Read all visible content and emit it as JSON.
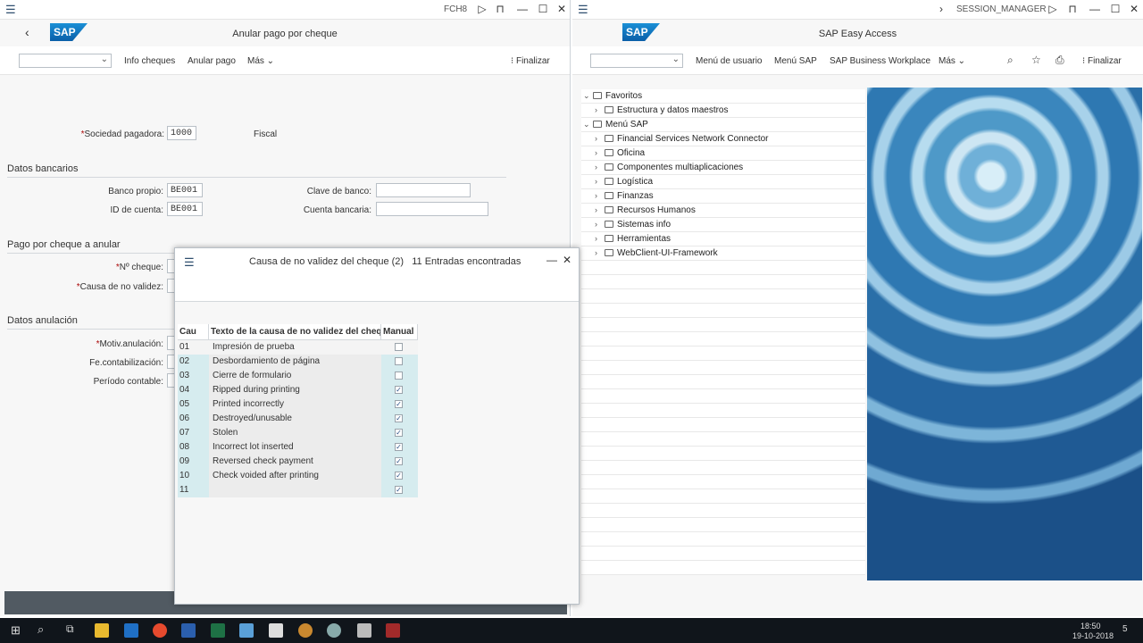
{
  "left_window": {
    "tcode": "FCH8",
    "title": "Anular pago por cheque",
    "toolbar": {
      "info_cheques": "Info cheques",
      "anular_pago": "Anular pago",
      "mas": "Más",
      "finalizar": "Finalizar"
    },
    "form": {
      "sociedad_label": "Sociedad pagadora:",
      "sociedad_value": "1000",
      "fiscal": "Fiscal",
      "datos_bancarios": "Datos bancarios",
      "banco_propio_label": "Banco propio:",
      "banco_propio_value": "BE001",
      "id_cuenta_label": "ID de cuenta:",
      "id_cuenta_value": "BE001",
      "clave_banco_label": "Clave de banco:",
      "cuenta_bancaria_label": "Cuenta bancaria:",
      "pago_cheque": "Pago por cheque a anular",
      "num_cheque_label": "Nº cheque:",
      "causa_label": "Causa de no validez:",
      "datos_anulacion": "Datos anulación",
      "motiv_label": "Motiv.anulación:",
      "fe_contab_label": "Fe.contabilización:",
      "periodo_label": "Período contable:"
    }
  },
  "dialog": {
    "title": "Causa de no validez del cheque (2)",
    "count": "11 Entradas encontradas",
    "columns": [
      "Cau",
      "Texto de la causa de no validez del cheq",
      "Manual"
    ],
    "rows": [
      {
        "code": "01",
        "text": "Impresión de prueba",
        "manual": false
      },
      {
        "code": "02",
        "text": "Desbordamiento de página",
        "manual": false
      },
      {
        "code": "03",
        "text": "Cierre de formulario",
        "manual": false
      },
      {
        "code": "04",
        "text": "Ripped during printing",
        "manual": true
      },
      {
        "code": "05",
        "text": "Printed incorrectly",
        "manual": true
      },
      {
        "code": "06",
        "text": "Destroyed/unusable",
        "manual": true
      },
      {
        "code": "07",
        "text": "Stolen",
        "manual": true
      },
      {
        "code": "08",
        "text": "Incorrect lot inserted",
        "manual": true
      },
      {
        "code": "09",
        "text": "Reversed check payment",
        "manual": true
      },
      {
        "code": "10",
        "text": "Check voided after printing",
        "manual": true
      },
      {
        "code": "11",
        "text": "",
        "manual": true
      }
    ]
  },
  "right_window": {
    "session": "SESSION_MANAGER",
    "title": "SAP Easy Access",
    "toolbar": {
      "menu_usuario": "Menú de usuario",
      "menu_sap": "Menú SAP",
      "workplace": "SAP Business Workplace",
      "mas": "Más",
      "finalizar": "Finalizar"
    },
    "tree": [
      {
        "label": "Favoritos",
        "level": 0,
        "expanded": true
      },
      {
        "label": "Estructura y datos maestros",
        "level": 1
      },
      {
        "label": "Menú SAP",
        "level": 0,
        "expanded": true
      },
      {
        "label": "Financial Services Network Connector",
        "level": 1
      },
      {
        "label": "Oficina",
        "level": 1
      },
      {
        "label": "Componentes multiaplicaciones",
        "level": 1
      },
      {
        "label": "Logística",
        "level": 1
      },
      {
        "label": "Finanzas",
        "level": 1
      },
      {
        "label": "Recursos Humanos",
        "level": 1
      },
      {
        "label": "Sistemas info",
        "level": 1
      },
      {
        "label": "Herramientas",
        "level": 1
      },
      {
        "label": "WebClient-UI-Framework",
        "level": 1
      }
    ]
  },
  "sap_logo": "SAP",
  "taskbar": {
    "time": "18:50",
    "date": "19-10-2018",
    "notif_count": "5"
  }
}
